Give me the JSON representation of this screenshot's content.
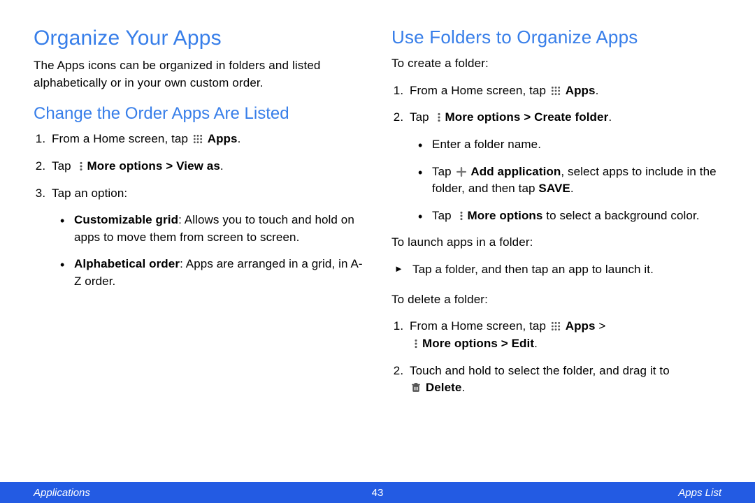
{
  "left": {
    "title": "Organize Your Apps",
    "intro": "The Apps icons can be organized in folders and listed alphabetically or in your own custom order.",
    "section1_title": "Change the Order Apps Are Listed",
    "s1_step1_a": "From a Home screen, tap ",
    "s1_step1_b": "Apps",
    "s1_step1_c": ".",
    "s1_step2_a": "Tap ",
    "s1_step2_b": "More options > View as",
    "s1_step2_c": ".",
    "s1_step3": "Tap an option:",
    "s1_b1_bold": "Customizable grid",
    "s1_b1_rest": ": Allows you to touch and hold on apps to move them from screen to screen.",
    "s1_b2_bold": "Alphabetical order",
    "s1_b2_rest": ": Apps are arranged in a grid, in A-Z order."
  },
  "right": {
    "title": "Use Folders to Organize Apps",
    "create_intro": "To create a folder:",
    "c_step1_a": "From a Home screen, tap ",
    "c_step1_b": "Apps",
    "c_step1_c": ".",
    "c_step2_a": "Tap ",
    "c_step2_b": "More options > Create folder",
    "c_step2_c": ".",
    "c_b1": "Enter a folder name.",
    "c_b2_a": "Tap ",
    "c_b2_b": "Add application",
    "c_b2_c": ", select apps to include in the folder, and then tap ",
    "c_b2_d": "SAVE",
    "c_b2_e": ".",
    "c_b3_a": "Tap ",
    "c_b3_b": "More options",
    "c_b3_c": " to select a background color.",
    "launch_intro": "To launch apps in a folder:",
    "launch_step": "Tap a folder, and then tap an app to launch it.",
    "delete_intro": "To delete a folder:",
    "d_step1_a": "From a Home screen, tap ",
    "d_step1_b": "Apps",
    "d_step1_c": " > ",
    "d_step1_d": "More options > Edit",
    "d_step1_e": ".",
    "d_step2_a": "Touch and hold to select the folder, and drag it to ",
    "d_step2_b": "Delete",
    "d_step2_c": "."
  },
  "footer": {
    "left": "Applications",
    "center": "43",
    "right": "Apps List"
  }
}
